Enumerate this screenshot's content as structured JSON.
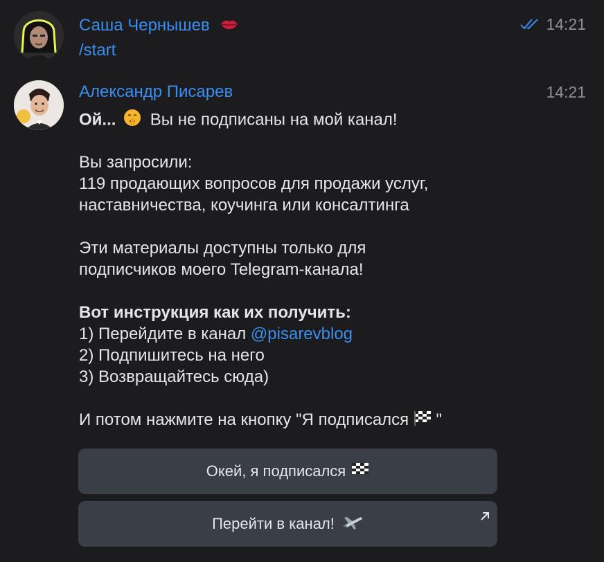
{
  "messages": [
    {
      "sender": "Саша Чернышев",
      "sender_emoji": "lips-emoji",
      "time": "14:21",
      "read_status": "double-check-icon",
      "text": "/start"
    },
    {
      "sender": "Александр Писарев",
      "time": "14:21",
      "intro_bold": "Ой...",
      "intro_emoji": "shushing-face-emoji",
      "intro_rest": "Вы не подписаны на мой канал!",
      "request_label": "Вы запросили:",
      "request_line1": "119 продающих вопросов для продажи услуг,",
      "request_line2": "наставничества, коучинга или консалтинга",
      "materials_line1": "Эти материалы доступны только для",
      "materials_line2": "подписчиков моего Telegram-канала!",
      "instructions_title": "Вот инструкция как их получить:",
      "step1_prefix": "1) Перейдите в канал ",
      "step1_mention": "@pisarevblog",
      "step2": "2) Подпишитесь на него",
      "step3": "3) Возвращайтесь сюда)",
      "final_prefix": "И потом нажмите на кнопку \"Я подписался ",
      "final_emoji": "checkered-flag-emoji",
      "final_suffix": " \""
    }
  ],
  "keyboard": {
    "subscribed_button": "Окей, я подписался",
    "subscribed_emoji": "checkered-flag-emoji",
    "channel_button": "Перейти в канал!",
    "channel_emoji": "airplane-emoji",
    "channel_button_icon": "external-link-arrow-icon"
  },
  "colors": {
    "background": "#1c1c1e",
    "accent": "#3a8ef0",
    "button_bg": "#3a3f47",
    "muted": "#8e8e93"
  }
}
